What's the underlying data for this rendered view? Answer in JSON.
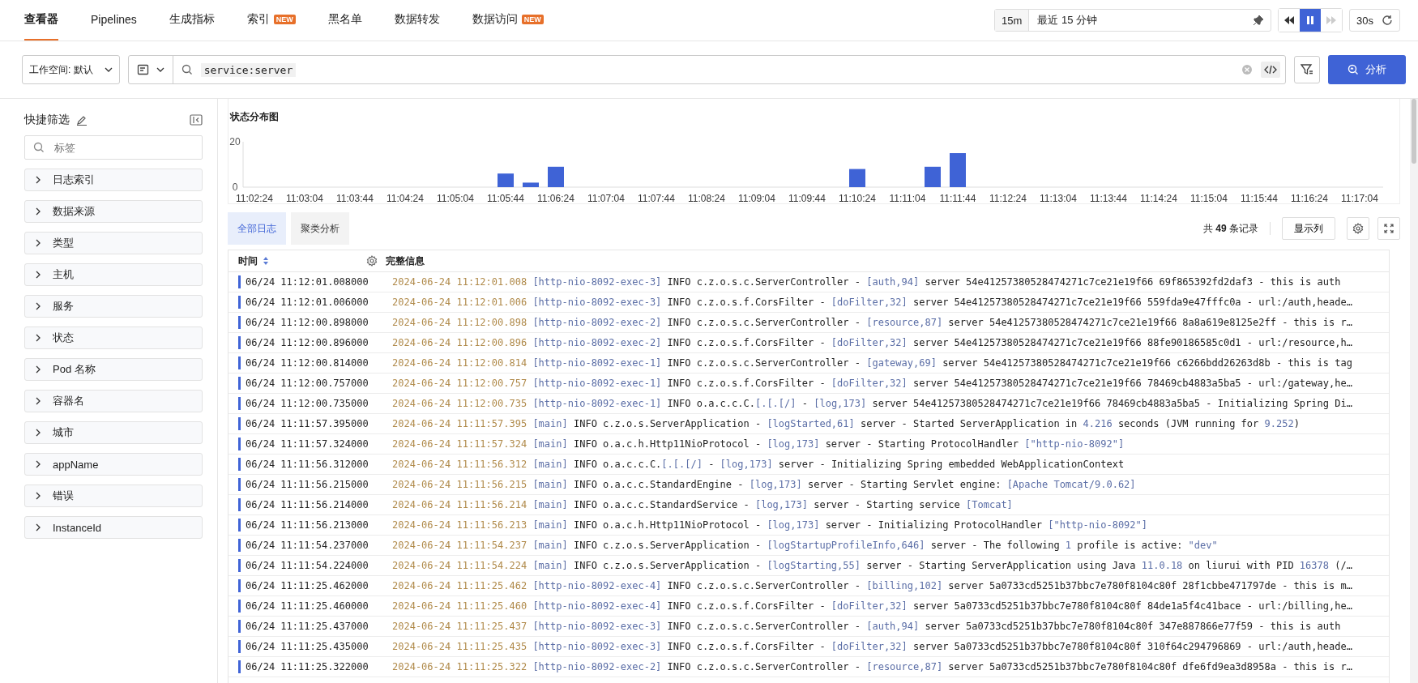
{
  "nav": {
    "tabs": [
      {
        "label": "查看器",
        "selected": true
      },
      {
        "label": "Pipelines",
        "selected": false
      },
      {
        "label": "生成指标",
        "selected": false
      },
      {
        "label": "索引",
        "selected": false,
        "badge": "NEW"
      },
      {
        "label": "黑名单",
        "selected": false
      },
      {
        "label": "数据转发",
        "selected": false
      },
      {
        "label": "数据访问",
        "selected": false,
        "badge": "NEW"
      }
    ],
    "time_range": {
      "short": "15m",
      "label": "最近 15 分钟"
    },
    "playback": {
      "paused": true,
      "forward_disabled": true
    },
    "refresh": {
      "interval": "30s"
    }
  },
  "query": {
    "workspace": "工作空间: 默认",
    "value": "service:server",
    "button": "分析"
  },
  "sidebar": {
    "title": "快捷筛选",
    "search_placeholder": "标签",
    "items": [
      {
        "label": "日志索引",
        "expanded": false
      },
      {
        "label": "数据来源",
        "expanded": false
      },
      {
        "label": "类型",
        "expanded": false
      },
      {
        "label": "主机",
        "expanded": false
      },
      {
        "label": "服务",
        "expanded": false
      },
      {
        "label": "状态",
        "expanded": false
      },
      {
        "label": "Pod 名称",
        "expanded": false
      },
      {
        "label": "容器名",
        "expanded": false
      },
      {
        "label": "城市",
        "expanded": false
      },
      {
        "label": "appName",
        "expanded": false
      },
      {
        "label": "错误",
        "expanded": false
      },
      {
        "label": "InstanceId",
        "expanded": false
      }
    ]
  },
  "chart": {
    "chart_data": {
      "type": "bar",
      "title": "状态分布图",
      "categories": [
        "11:02:24",
        null,
        "11:03:04",
        null,
        "11:03:44",
        null,
        "11:04:24",
        null,
        "11:05:04",
        null,
        "11:05:44",
        null,
        "11:06:24",
        null,
        "11:07:04",
        null,
        "11:07:44",
        null,
        "11:08:24",
        null,
        "11:09:04",
        null,
        "11:09:44",
        null,
        "11:10:24",
        null,
        "11:11:04",
        null,
        "11:11:44",
        null,
        "11:12:24",
        null,
        "11:13:04",
        null,
        "11:13:44",
        null,
        "11:14:24",
        null,
        "11:15:04",
        null,
        "11:15:44",
        null,
        "11:16:24",
        null,
        "11:17:04"
      ],
      "values": [
        0,
        0,
        0,
        0,
        0,
        0,
        0,
        0,
        0,
        0,
        6,
        2,
        9,
        0,
        0,
        0,
        0,
        0,
        0,
        0,
        0,
        0,
        0,
        0,
        8,
        0,
        0,
        9,
        15,
        0,
        0,
        0,
        0,
        0,
        0,
        0,
        0,
        0,
        0,
        0,
        0,
        0,
        0,
        0,
        0
      ],
      "ylim": [
        0,
        20
      ],
      "yticks": [
        0,
        20
      ]
    }
  },
  "log_tabs": [
    {
      "label": "全部日志",
      "selected": true
    },
    {
      "label": "聚类分析",
      "selected": false
    }
  ],
  "record_count": "共 **49** 条记录",
  "columns_button": "显示列",
  "table": {
    "columns": [
      {
        "label": "时间"
      },
      {
        "label": "完整信息"
      }
    ],
    "rows": [
      {
        "time": "06/24 11:12:01.008000",
        "parts": [
          {
            "kind": "date",
            "text": "2024-06-24 11:12:01.008"
          },
          {
            "kind": "tag",
            "text": "[http-nio-8092-exec-3]"
          },
          {
            "kind": "text",
            "text": " INFO c.z.o.s.c.ServerController - "
          },
          {
            "kind": "tag",
            "text": "[auth,94]"
          },
          {
            "kind": "text",
            "text": " server 54e41257380528474271c7ce21e19f66 69f865392fd2daf3 - this is auth"
          }
        ]
      },
      {
        "time": "06/24 11:12:01.006000",
        "parts": [
          {
            "kind": "date",
            "text": "2024-06-24 11:12:01.006"
          },
          {
            "kind": "tag",
            "text": "[http-nio-8092-exec-3]"
          },
          {
            "kind": "text",
            "text": " INFO c.z.o.s.f.CorsFilter - "
          },
          {
            "kind": "tag",
            "text": "[doFilter,32]"
          },
          {
            "kind": "text",
            "text": " server 54e41257380528474271c7ce21e19f66 559fda9e47fffc0a - url:/auth,heade…"
          }
        ]
      },
      {
        "time": "06/24 11:12:00.898000",
        "parts": [
          {
            "kind": "date",
            "text": "2024-06-24 11:12:00.898"
          },
          {
            "kind": "tag",
            "text": "[http-nio-8092-exec-2]"
          },
          {
            "kind": "text",
            "text": " INFO c.z.o.s.c.ServerController - "
          },
          {
            "kind": "tag",
            "text": "[resource,87]"
          },
          {
            "kind": "text",
            "text": " server 54e41257380528474271c7ce21e19f66 8a8a619e8125e2ff - this is r…"
          }
        ]
      },
      {
        "time": "06/24 11:12:00.896000",
        "parts": [
          {
            "kind": "date",
            "text": "2024-06-24 11:12:00.896"
          },
          {
            "kind": "tag",
            "text": "[http-nio-8092-exec-2]"
          },
          {
            "kind": "text",
            "text": " INFO c.z.o.s.f.CorsFilter - "
          },
          {
            "kind": "tag",
            "text": "[doFilter,32]"
          },
          {
            "kind": "text",
            "text": " server 54e41257380528474271c7ce21e19f66 88fe90186585c0d1 - url:/resource,h…"
          }
        ]
      },
      {
        "time": "06/24 11:12:00.814000",
        "parts": [
          {
            "kind": "date",
            "text": "2024-06-24 11:12:00.814"
          },
          {
            "kind": "tag",
            "text": "[http-nio-8092-exec-1]"
          },
          {
            "kind": "text",
            "text": " INFO c.z.o.s.c.ServerController - "
          },
          {
            "kind": "tag",
            "text": "[gateway,69]"
          },
          {
            "kind": "text",
            "text": " server 54e41257380528474271c7ce21e19f66 c6266bdd26263d8b - this is tag"
          }
        ]
      },
      {
        "time": "06/24 11:12:00.757000",
        "parts": [
          {
            "kind": "date",
            "text": "2024-06-24 11:12:00.757"
          },
          {
            "kind": "tag",
            "text": "[http-nio-8092-exec-1]"
          },
          {
            "kind": "text",
            "text": " INFO c.z.o.s.f.CorsFilter - "
          },
          {
            "kind": "tag",
            "text": "[doFilter,32]"
          },
          {
            "kind": "text",
            "text": " server 54e41257380528474271c7ce21e19f66 78469cb4883a5ba5 - url:/gateway,he…"
          }
        ]
      },
      {
        "time": "06/24 11:12:00.735000",
        "parts": [
          {
            "kind": "date",
            "text": "2024-06-24 11:12:00.735"
          },
          {
            "kind": "tag",
            "text": "[http-nio-8092-exec-1]"
          },
          {
            "kind": "text",
            "text": " INFO o.a.c.c.C."
          },
          {
            "kind": "tag",
            "text": "[.[.[/]"
          },
          {
            "kind": "text",
            "text": " - "
          },
          {
            "kind": "tag",
            "text": "[log,173]"
          },
          {
            "kind": "text",
            "text": " server 54e41257380528474271c7ce21e19f66 78469cb4883a5ba5 - Initializing Spring Di…"
          }
        ]
      },
      {
        "time": "06/24 11:11:57.395000",
        "parts": [
          {
            "kind": "date",
            "text": "2024-06-24 11:11:57.395"
          },
          {
            "kind": "tag",
            "text": "[main]"
          },
          {
            "kind": "text",
            "text": " INFO c.z.o.s.ServerApplication - "
          },
          {
            "kind": "tag",
            "text": "[logStarted,61]"
          },
          {
            "kind": "text",
            "text": " server - Started ServerApplication in "
          },
          {
            "kind": "num",
            "text": "4.216"
          },
          {
            "kind": "text",
            "text": " seconds (JVM running for "
          },
          {
            "kind": "num",
            "text": "9.252"
          },
          {
            "kind": "text",
            "text": ")"
          }
        ]
      },
      {
        "time": "06/24 11:11:57.324000",
        "parts": [
          {
            "kind": "date",
            "text": "2024-06-24 11:11:57.324"
          },
          {
            "kind": "tag",
            "text": "[main]"
          },
          {
            "kind": "text",
            "text": " INFO o.a.c.h.Http11NioProtocol - "
          },
          {
            "kind": "tag",
            "text": "[log,173]"
          },
          {
            "kind": "text",
            "text": " server - Starting ProtocolHandler "
          },
          {
            "kind": "tag",
            "text": "[\"http-nio-8092\"]"
          }
        ]
      },
      {
        "time": "06/24 11:11:56.312000",
        "parts": [
          {
            "kind": "date",
            "text": "2024-06-24 11:11:56.312"
          },
          {
            "kind": "tag",
            "text": "[main]"
          },
          {
            "kind": "text",
            "text": " INFO o.a.c.c.C."
          },
          {
            "kind": "tag",
            "text": "[.[.[/]"
          },
          {
            "kind": "text",
            "text": " - "
          },
          {
            "kind": "tag",
            "text": "[log,173]"
          },
          {
            "kind": "text",
            "text": " server - Initializing Spring embedded WebApplicationContext"
          }
        ]
      },
      {
        "time": "06/24 11:11:56.215000",
        "parts": [
          {
            "kind": "date",
            "text": "2024-06-24 11:11:56.215"
          },
          {
            "kind": "tag",
            "text": "[main]"
          },
          {
            "kind": "text",
            "text": " INFO o.a.c.c.StandardEngine - "
          },
          {
            "kind": "tag",
            "text": "[log,173]"
          },
          {
            "kind": "text",
            "text": " server - Starting Servlet engine: "
          },
          {
            "kind": "tag",
            "text": "[Apache Tomcat/9.0.62]"
          }
        ]
      },
      {
        "time": "06/24 11:11:56.214000",
        "parts": [
          {
            "kind": "date",
            "text": "2024-06-24 11:11:56.214"
          },
          {
            "kind": "tag",
            "text": "[main]"
          },
          {
            "kind": "text",
            "text": " INFO o.a.c.c.StandardService - "
          },
          {
            "kind": "tag",
            "text": "[log,173]"
          },
          {
            "kind": "text",
            "text": " server - Starting service "
          },
          {
            "kind": "tag",
            "text": "[Tomcat]"
          }
        ]
      },
      {
        "time": "06/24 11:11:56.213000",
        "parts": [
          {
            "kind": "date",
            "text": "2024-06-24 11:11:56.213"
          },
          {
            "kind": "tag",
            "text": "[main]"
          },
          {
            "kind": "text",
            "text": " INFO o.a.c.h.Http11NioProtocol - "
          },
          {
            "kind": "tag",
            "text": "[log,173]"
          },
          {
            "kind": "text",
            "text": " server - Initializing ProtocolHandler "
          },
          {
            "kind": "tag",
            "text": "[\"http-nio-8092\"]"
          }
        ]
      },
      {
        "time": "06/24 11:11:54.237000",
        "parts": [
          {
            "kind": "date",
            "text": "2024-06-24 11:11:54.237"
          },
          {
            "kind": "tag",
            "text": "[main]"
          },
          {
            "kind": "text",
            "text": " INFO c.z.o.s.ServerApplication - "
          },
          {
            "kind": "tag",
            "text": "[logStartupProfileInfo,646]"
          },
          {
            "kind": "text",
            "text": " server - The following "
          },
          {
            "kind": "num",
            "text": "1"
          },
          {
            "kind": "text",
            "text": " profile is active: "
          },
          {
            "kind": "num",
            "text": "\"dev\""
          }
        ]
      },
      {
        "time": "06/24 11:11:54.224000",
        "parts": [
          {
            "kind": "date",
            "text": "2024-06-24 11:11:54.224"
          },
          {
            "kind": "tag",
            "text": "[main]"
          },
          {
            "kind": "text",
            "text": " INFO c.z.o.s.ServerApplication - "
          },
          {
            "kind": "tag",
            "text": "[logStarting,55]"
          },
          {
            "kind": "text",
            "text": " server - Starting ServerApplication using Java "
          },
          {
            "kind": "num",
            "text": "11.0.18"
          },
          {
            "kind": "text",
            "text": " on liurui with PID "
          },
          {
            "kind": "num",
            "text": "16378"
          },
          {
            "kind": "text",
            "text": " (/…"
          }
        ]
      },
      {
        "time": "06/24 11:11:25.462000",
        "parts": [
          {
            "kind": "date",
            "text": "2024-06-24 11:11:25.462"
          },
          {
            "kind": "tag",
            "text": "[http-nio-8092-exec-4]"
          },
          {
            "kind": "text",
            "text": " INFO c.z.o.s.c.ServerController - "
          },
          {
            "kind": "tag",
            "text": "[billing,102]"
          },
          {
            "kind": "text",
            "text": " server 5a0733cd5251b37bbc7e780f8104c80f 28f1cbbe471797de - this is m…"
          }
        ]
      },
      {
        "time": "06/24 11:11:25.460000",
        "parts": [
          {
            "kind": "date",
            "text": "2024-06-24 11:11:25.460"
          },
          {
            "kind": "tag",
            "text": "[http-nio-8092-exec-4]"
          },
          {
            "kind": "text",
            "text": " INFO c.z.o.s.f.CorsFilter - "
          },
          {
            "kind": "tag",
            "text": "[doFilter,32]"
          },
          {
            "kind": "text",
            "text": " server 5a0733cd5251b37bbc7e780f8104c80f 84de1a5f4c41bace - url:/billing,he…"
          }
        ]
      },
      {
        "time": "06/24 11:11:25.437000",
        "parts": [
          {
            "kind": "date",
            "text": "2024-06-24 11:11:25.437"
          },
          {
            "kind": "tag",
            "text": "[http-nio-8092-exec-3]"
          },
          {
            "kind": "text",
            "text": " INFO c.z.o.s.c.ServerController - "
          },
          {
            "kind": "tag",
            "text": "[auth,94]"
          },
          {
            "kind": "text",
            "text": " server 5a0733cd5251b37bbc7e780f8104c80f 347e887866e77f59 - this is auth"
          }
        ]
      },
      {
        "time": "06/24 11:11:25.435000",
        "parts": [
          {
            "kind": "date",
            "text": "2024-06-24 11:11:25.435"
          },
          {
            "kind": "tag",
            "text": "[http-nio-8092-exec-3]"
          },
          {
            "kind": "text",
            "text": " INFO c.z.o.s.f.CorsFilter - "
          },
          {
            "kind": "tag",
            "text": "[doFilter,32]"
          },
          {
            "kind": "text",
            "text": " server 5a0733cd5251b37bbc7e780f8104c80f 310f64c294796869 - url:/auth,heade…"
          }
        ]
      },
      {
        "time": "06/24 11:11:25.322000",
        "parts": [
          {
            "kind": "date",
            "text": "2024-06-24 11:11:25.322"
          },
          {
            "kind": "tag",
            "text": "[http-nio-8092-exec-2]"
          },
          {
            "kind": "text",
            "text": " INFO c.z.o.s.c.ServerController - "
          },
          {
            "kind": "tag",
            "text": "[resource,87]"
          },
          {
            "kind": "text",
            "text": " server 5a0733cd5251b37bbc7e780f8104c80f dfe6fd9ea3d8958a - this is r…"
          }
        ]
      }
    ]
  }
}
